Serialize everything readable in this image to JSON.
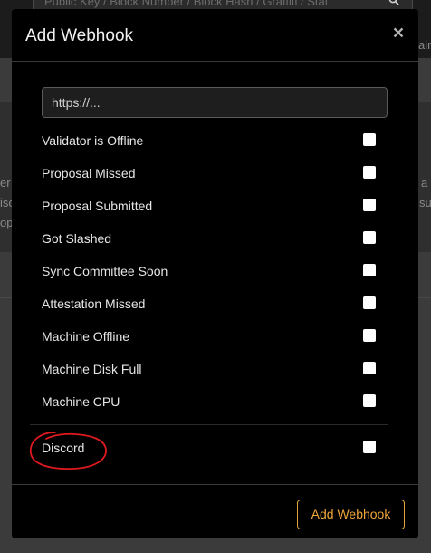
{
  "background": {
    "search_placeholder": "Public Key / Block Number / Block Hash / Graffiti / Stat",
    "edge_fragments": [
      "ain",
      "er",
      "isc",
      "op",
      "a",
      "su"
    ]
  },
  "modal": {
    "title": "Add Webhook",
    "close_glyph": "×",
    "url_placeholder": "https://...",
    "url_value": "",
    "events": [
      {
        "label": "Validator is Offline",
        "checked": false
      },
      {
        "label": "Proposal Missed",
        "checked": false
      },
      {
        "label": "Proposal Submitted",
        "checked": false
      },
      {
        "label": "Got Slashed",
        "checked": false
      },
      {
        "label": "Sync Committee Soon",
        "checked": false
      },
      {
        "label": "Attestation Missed",
        "checked": false
      },
      {
        "label": "Machine Offline",
        "checked": false
      },
      {
        "label": "Machine Disk Full",
        "checked": false
      },
      {
        "label": "Machine CPU",
        "checked": false
      }
    ],
    "discord": {
      "label": "Discord",
      "checked": false
    },
    "submit_label": "Add Webhook"
  },
  "colors": {
    "accent": "#f0a63b",
    "annotation": "#e0191f",
    "modal_bg": "#000000"
  }
}
